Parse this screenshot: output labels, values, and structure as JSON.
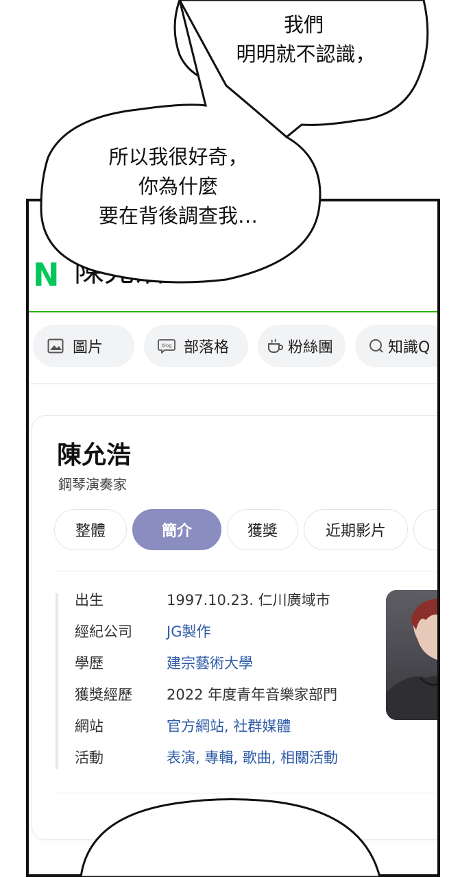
{
  "bubbles": {
    "top": {
      "line1": "我們",
      "line2": "明明就不認識，"
    },
    "middle": {
      "line1": "所以我很好奇，",
      "line2": "你為什麼",
      "line3": "要在背後調查我…"
    }
  },
  "search": {
    "logo": "N",
    "query": "陳允浩"
  },
  "chips": [
    {
      "label": "圖片",
      "icon": "image-icon"
    },
    {
      "label": "部落格",
      "icon": "blog-icon"
    },
    {
      "label": "粉絲團",
      "icon": "cafe-icon"
    },
    {
      "label": "知識Q",
      "icon": "search-q-icon"
    }
  ],
  "profile": {
    "name": "陳允浩",
    "subtitle": "鋼琴演奏家",
    "tabs": [
      {
        "label": "整體",
        "active": false
      },
      {
        "label": "簡介",
        "active": true
      },
      {
        "label": "獲獎",
        "active": false
      },
      {
        "label": "近期影片",
        "active": false
      }
    ],
    "info": [
      {
        "label": "出生",
        "value": "1997.10.23. 仁川廣域市",
        "link": false
      },
      {
        "label": "經紀公司",
        "value": "JG製作",
        "link": true
      },
      {
        "label": "學歷",
        "value": "建宗藝術大學",
        "link": true
      },
      {
        "label": "獲獎經歷",
        "value": "2022 年度青年音樂家部門",
        "link": false
      },
      {
        "label": "網站",
        "value": "官方網站, 社群媒體",
        "link": true
      },
      {
        "label": "活動",
        "value": "表演, 專輯, 歌曲, 相關活動",
        "link": true
      }
    ]
  },
  "colors": {
    "brand_green": "#03c75a",
    "active_tab": "#8a8dc0",
    "link": "#2e5ba8"
  }
}
